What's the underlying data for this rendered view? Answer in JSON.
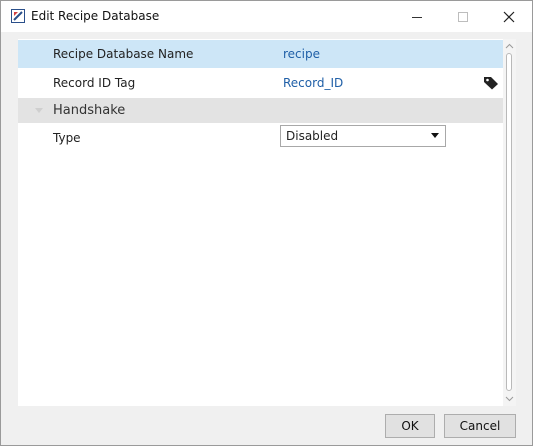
{
  "window": {
    "title": "Edit Recipe Database",
    "app_icon": "recipe-db-app-icon",
    "controls": [
      "minimize-icon",
      "maximize-icon",
      "close-icon"
    ]
  },
  "properties": {
    "database_name": {
      "label": "Recipe Database Name",
      "value": "recipe"
    },
    "record_id_tag": {
      "label": "Record ID Tag",
      "value": "Record_ID",
      "icon": "tag-icon"
    },
    "handshake_group": {
      "label": "Handshake",
      "expanded": true
    },
    "type": {
      "label": "Type",
      "selected": "Disabled"
    }
  },
  "footer": {
    "ok_label": "OK",
    "cancel_label": "Cancel"
  },
  "colors": {
    "selected_row": "#cde6f7",
    "value_text": "#1f5fa7",
    "group_header": "#e3e3e3"
  }
}
